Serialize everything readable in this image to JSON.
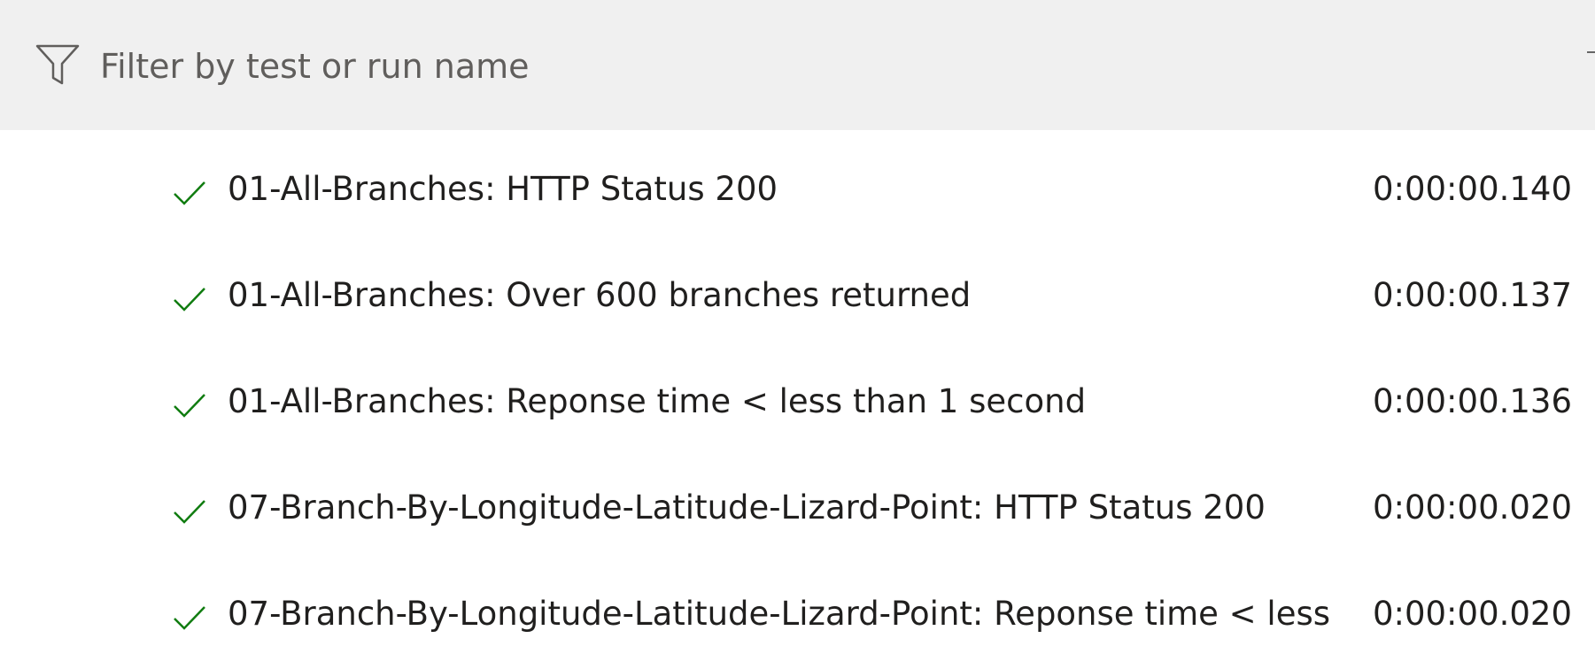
{
  "filter": {
    "placeholder": "Filter by test or run name",
    "value": ""
  },
  "colors": {
    "filter_bar_bg": "#f0f0f0",
    "pass_check": "#107c10"
  },
  "results": [
    {
      "status": "passed",
      "status_icon": "check-icon",
      "name": "01-All-Branches: HTTP Status 200",
      "duration": "0:00:00.140"
    },
    {
      "status": "passed",
      "status_icon": "check-icon",
      "name": "01-All-Branches: Over 600 branches returned",
      "duration": "0:00:00.137"
    },
    {
      "status": "passed",
      "status_icon": "check-icon",
      "name": "01-All-Branches: Reponse time < less than 1 second",
      "duration": "0:00:00.136"
    },
    {
      "status": "passed",
      "status_icon": "check-icon",
      "name": "07-Branch-By-Longitude-Latitude-Lizard-Point: HTTP Status 200",
      "duration": "0:00:00.020"
    },
    {
      "status": "passed",
      "status_icon": "check-icon",
      "name": "07-Branch-By-Longitude-Latitude-Lizard-Point: Reponse time < less",
      "duration": "0:00:00.020"
    }
  ]
}
